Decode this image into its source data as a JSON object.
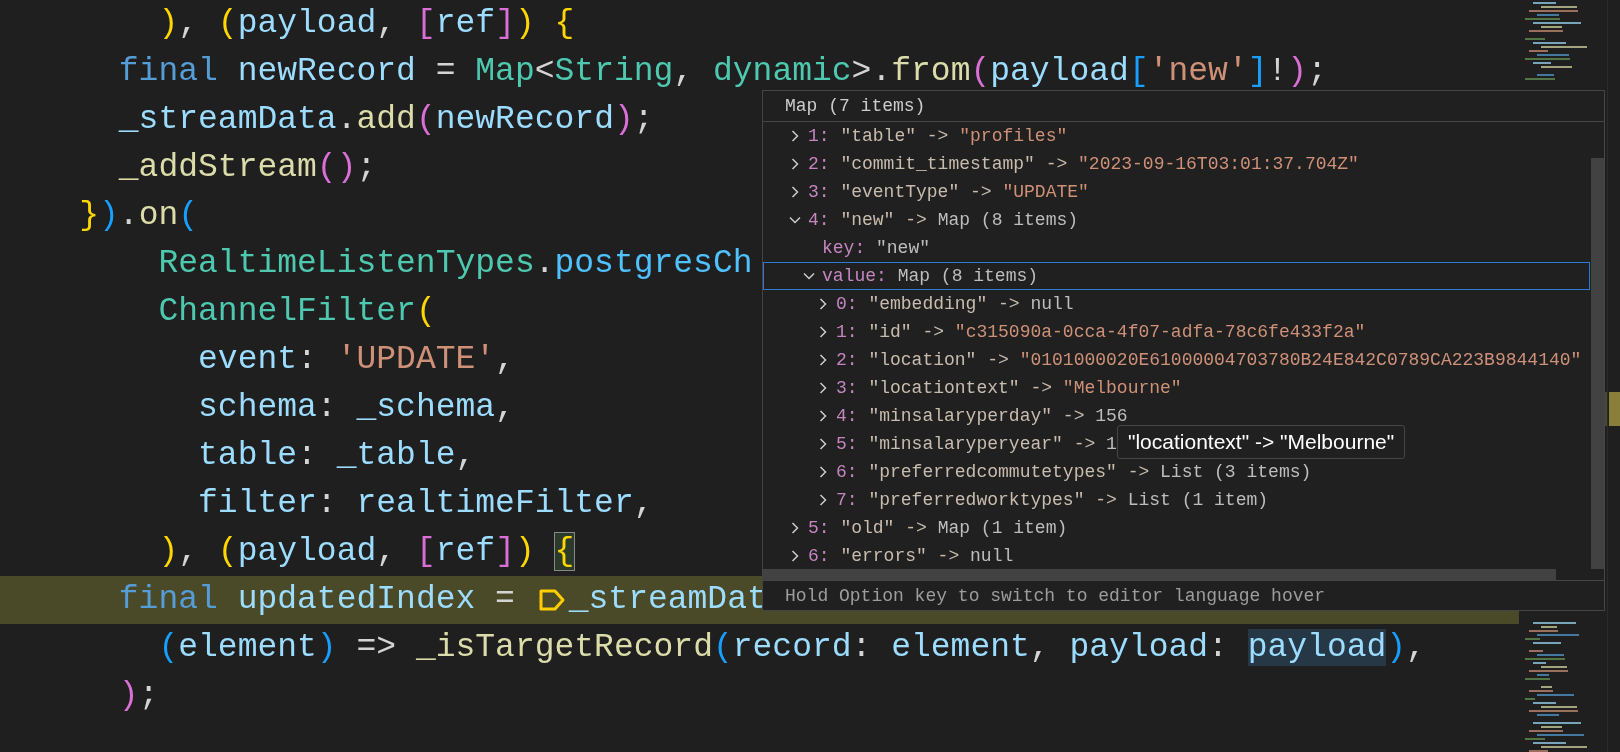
{
  "editor": {
    "lines": [
      {
        "current": false,
        "tokens": [
          {
            "text": "        )",
            "kind": "bracket1"
          },
          {
            "text": ", ",
            "kind": "plain"
          },
          {
            "text": "(",
            "kind": "bracket1"
          },
          {
            "text": "payload",
            "kind": "variable"
          },
          {
            "text": ", ",
            "kind": "plain"
          },
          {
            "text": "[",
            "kind": "bracket2"
          },
          {
            "text": "ref",
            "kind": "variable"
          },
          {
            "text": "]",
            "kind": "bracket2"
          },
          {
            "text": ") {",
            "kind": "bracket1"
          }
        ]
      },
      {
        "current": false,
        "tokens": [
          {
            "text": "      final",
            "kind": "keyword"
          },
          {
            "text": " newRecord",
            "kind": "variable"
          },
          {
            "text": " = ",
            "kind": "plain"
          },
          {
            "text": "Map",
            "kind": "type"
          },
          {
            "text": "<",
            "kind": "plain"
          },
          {
            "text": "String",
            "kind": "type"
          },
          {
            "text": ", ",
            "kind": "plain"
          },
          {
            "text": "dynamic",
            "kind": "type"
          },
          {
            "text": ">.",
            "kind": "plain"
          },
          {
            "text": "from",
            "kind": "function"
          },
          {
            "text": "(",
            "kind": "bracket2"
          },
          {
            "text": "payload",
            "kind": "variable"
          },
          {
            "text": "[",
            "kind": "bracket3"
          },
          {
            "text": "'new'",
            "kind": "string"
          },
          {
            "text": "]",
            "kind": "bracket3"
          },
          {
            "text": "!",
            "kind": "plain"
          },
          {
            "text": ")",
            "kind": "bracket2"
          },
          {
            "text": ";",
            "kind": "plain"
          }
        ]
      },
      {
        "current": false,
        "tokens": [
          {
            "text": "      _streamData",
            "kind": "variable"
          },
          {
            "text": ".",
            "kind": "plain"
          },
          {
            "text": "add",
            "kind": "function"
          },
          {
            "text": "(",
            "kind": "bracket2"
          },
          {
            "text": "newRecord",
            "kind": "variable"
          },
          {
            "text": ")",
            "kind": "bracket2"
          },
          {
            "text": ";",
            "kind": "plain"
          }
        ]
      },
      {
        "current": false,
        "tokens": [
          {
            "text": "      _addStream",
            "kind": "function"
          },
          {
            "text": "()",
            "kind": "bracket2"
          },
          {
            "text": ";",
            "kind": "plain"
          }
        ]
      },
      {
        "current": false,
        "tokens": [
          {
            "text": "    }",
            "kind": "bracket1"
          },
          {
            "text": ")",
            "kind": "bracket3"
          },
          {
            "text": ".",
            "kind": "plain"
          },
          {
            "text": "on",
            "kind": "function"
          },
          {
            "text": "(",
            "kind": "bracket3"
          }
        ]
      },
      {
        "current": false,
        "tokens": [
          {
            "text": "        RealtimeListenTypes",
            "kind": "type"
          },
          {
            "text": ".",
            "kind": "plain"
          },
          {
            "text": "postgresCh",
            "kind": "property"
          }
        ]
      },
      {
        "current": false,
        "tokens": [
          {
            "text": "        ChannelFilter",
            "kind": "type"
          },
          {
            "text": "(",
            "kind": "bracket1"
          }
        ]
      },
      {
        "current": false,
        "tokens": [
          {
            "text": "          event",
            "kind": "variable"
          },
          {
            "text": ": ",
            "kind": "plain"
          },
          {
            "text": "'UPDATE'",
            "kind": "string"
          },
          {
            "text": ",",
            "kind": "plain"
          }
        ]
      },
      {
        "current": false,
        "tokens": [
          {
            "text": "          schema",
            "kind": "variable"
          },
          {
            "text": ": ",
            "kind": "plain"
          },
          {
            "text": "_schema",
            "kind": "variable"
          },
          {
            "text": ",",
            "kind": "plain"
          }
        ]
      },
      {
        "current": false,
        "tokens": [
          {
            "text": "          table",
            "kind": "variable"
          },
          {
            "text": ": ",
            "kind": "plain"
          },
          {
            "text": "_table",
            "kind": "variable"
          },
          {
            "text": ",",
            "kind": "plain"
          }
        ]
      },
      {
        "current": false,
        "tokens": [
          {
            "text": "          filter",
            "kind": "variable"
          },
          {
            "text": ": ",
            "kind": "plain"
          },
          {
            "text": "realtimeFilter",
            "kind": "variable"
          },
          {
            "text": ",",
            "kind": "plain"
          }
        ]
      },
      {
        "current": false,
        "tokens": [
          {
            "text": "        )",
            "kind": "bracket1"
          },
          {
            "text": ", ",
            "kind": "plain"
          },
          {
            "text": "(",
            "kind": "bracket1"
          },
          {
            "text": "payload",
            "kind": "variable"
          },
          {
            "text": ", ",
            "kind": "plain"
          },
          {
            "text": "[",
            "kind": "bracket2"
          },
          {
            "text": "ref",
            "kind": "variable"
          },
          {
            "text": "]",
            "kind": "bracket2"
          },
          {
            "text": ") ",
            "kind": "bracket1"
          },
          {
            "text": "{",
            "kind": "matched-bracket"
          }
        ]
      },
      {
        "current": true,
        "tokens": [
          {
            "text": "      final",
            "kind": "keyword"
          },
          {
            "text": " updatedIndex",
            "kind": "variable"
          },
          {
            "text": " = ",
            "kind": "plain"
          },
          {
            "kind": "marker"
          },
          {
            "text": "_streamDat",
            "kind": "variable"
          }
        ]
      },
      {
        "current": false,
        "tokens": [
          {
            "text": "        (",
            "kind": "bracket3"
          },
          {
            "text": "element",
            "kind": "variable"
          },
          {
            "text": ")",
            "kind": "bracket3"
          },
          {
            "text": " => ",
            "kind": "plain"
          },
          {
            "text": "_isTargetRecord",
            "kind": "function"
          },
          {
            "text": "(",
            "kind": "bracket3"
          },
          {
            "text": "record",
            "kind": "variable"
          },
          {
            "text": ": ",
            "kind": "plain"
          },
          {
            "text": "element",
            "kind": "variable"
          },
          {
            "text": ", ",
            "kind": "plain"
          },
          {
            "text": "payload",
            "kind": "variable"
          },
          {
            "text": ": ",
            "kind": "plain"
          },
          {
            "text": "payload",
            "kind": "highlighted-variable"
          },
          {
            "text": ")",
            "kind": "bracket3"
          },
          {
            "text": ",",
            "kind": "plain"
          }
        ]
      },
      {
        "current": false,
        "tokens": [
          {
            "text": "      )",
            "kind": "bracket2"
          },
          {
            "text": ";",
            "kind": "plain"
          }
        ]
      }
    ]
  },
  "hover": {
    "title": "Map (7 items)",
    "items": [
      {
        "kind": "node",
        "index": "1:",
        "key": "\"table\" ->",
        "value": "\"profiles\"",
        "is_string": true,
        "expanded": false,
        "focused": false
      },
      {
        "kind": "node",
        "index": "2:",
        "key": "\"commit_timestamp\" ->",
        "value": "\"2023-09-16T03:01:37.704Z\"",
        "is_string": true,
        "expanded": false,
        "focused": false
      },
      {
        "kind": "node",
        "index": "3:",
        "key": "\"eventType\" ->",
        "value": "\"UPDATE\"",
        "is_string": true,
        "expanded": false,
        "focused": false
      },
      {
        "kind": "node",
        "index": "4:",
        "key": "\"new\" ->",
        "value": "Map (8 items)",
        "is_string": false,
        "expanded": true,
        "focused": false,
        "children": [
          {
            "kind": "leaf",
            "index": "key:",
            "value": "\"new\"",
            "is_string": false,
            "focused": false
          },
          {
            "kind": "node",
            "index": "value:",
            "value": "Map (8 items)",
            "is_string": false,
            "expanded": true,
            "focused": true,
            "children": [
              {
                "kind": "node",
                "index": "0:",
                "key": "\"embedding\" ->",
                "value": "null",
                "is_string": false,
                "expanded": false,
                "focused": false
              },
              {
                "kind": "node",
                "index": "1:",
                "key": "\"id\" ->",
                "value": "\"c315090a-0cca-4f07-adfa-78c6fe433f2a\"",
                "is_string": true,
                "expanded": false,
                "focused": false
              },
              {
                "kind": "node",
                "index": "2:",
                "key": "\"location\" ->",
                "value": "\"0101000020E61000004703780B24E842C0789CA223B9844140\"",
                "is_string": true,
                "expanded": false,
                "focused": false
              },
              {
                "kind": "node",
                "index": "3:",
                "key": "\"locationtext\" ->",
                "value": "\"Melbourne\"",
                "is_string": true,
                "expanded": false,
                "focused": false
              },
              {
                "kind": "node",
                "index": "4:",
                "key": "\"minsalaryperday\" ->",
                "value": "156",
                "is_string": false,
                "expanded": false,
                "focused": false
              },
              {
                "kind": "node",
                "index": "5:",
                "key": "\"minsalaryperyear\" ->",
                "value": "1",
                "is_string": false,
                "expanded": false,
                "focused": false
              },
              {
                "kind": "node",
                "index": "6:",
                "key": "\"preferredcommutetypes\" ->",
                "value": "List (3 items)",
                "is_string": false,
                "expanded": false,
                "focused": false
              },
              {
                "kind": "node",
                "index": "7:",
                "key": "\"preferredworktypes\" ->",
                "value": "List (1 item)",
                "is_string": false,
                "expanded": false,
                "focused": false
              }
            ]
          }
        ]
      },
      {
        "kind": "node",
        "index": "5:",
        "key": "\"old\" ->",
        "value": "Map (1 item)",
        "is_string": false,
        "expanded": false,
        "focused": false
      },
      {
        "kind": "node",
        "index": "6:",
        "key": "\"errors\" ->",
        "value": "null",
        "is_string": false,
        "expanded": false,
        "focused": false
      }
    ],
    "hint": "Hold Option key to switch to editor language hover",
    "tooltip": "\"locationtext\" -> \"Melbourne\""
  }
}
